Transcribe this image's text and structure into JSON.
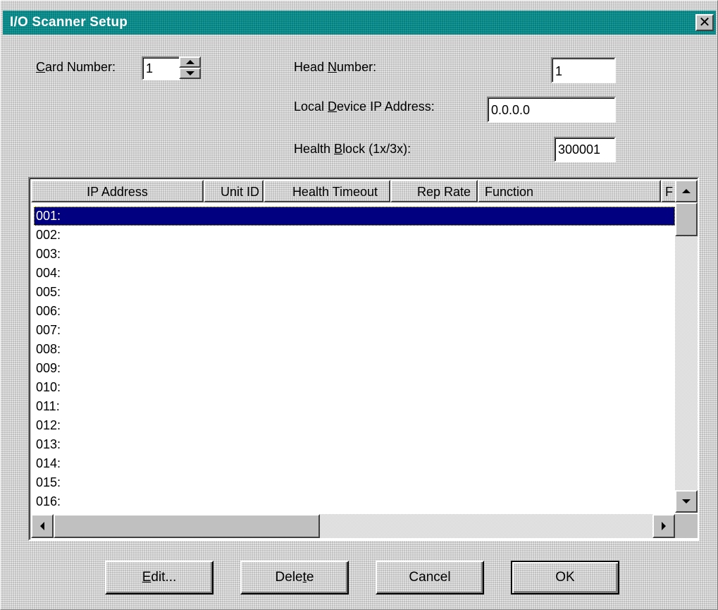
{
  "window": {
    "title": "I/O Scanner Setup",
    "close_symbol": "✕",
    "titlebar_color": "#008080"
  },
  "form": {
    "card_number": {
      "label": "Card Number:",
      "accel": "C",
      "value": "1"
    },
    "head_number": {
      "label": "Head Number:",
      "accel": "N",
      "value": "1"
    },
    "local_ip": {
      "label": "Local Device IP Address:",
      "accel": "D",
      "value": "0.0.0.0"
    },
    "health_block": {
      "label": "Health Block (1x/3x):",
      "accel": "B",
      "value": "300001"
    }
  },
  "table": {
    "columns": [
      "IP Address",
      "Unit ID",
      "Health Timeout",
      "Rep Rate",
      "Function",
      "F"
    ],
    "rows": [
      "001:",
      "002:",
      "003:",
      "004:",
      "005:",
      "006:",
      "007:",
      "008:",
      "009:",
      "010:",
      "011:",
      "012:",
      "013:",
      "014:",
      "015:",
      "016:"
    ],
    "selected_row": "001:",
    "selection_color": "#000080"
  },
  "buttons": {
    "edit": "Edit...",
    "delete": "Delete",
    "cancel": "Cancel",
    "ok": "OK"
  },
  "icons": {
    "spinner_up": "triangle-up-icon",
    "spinner_down": "triangle-down-icon",
    "scroll_up": "triangle-up-icon",
    "scroll_down": "triangle-down-icon",
    "scroll_left": "triangle-left-icon",
    "scroll_right": "triangle-right-icon"
  }
}
